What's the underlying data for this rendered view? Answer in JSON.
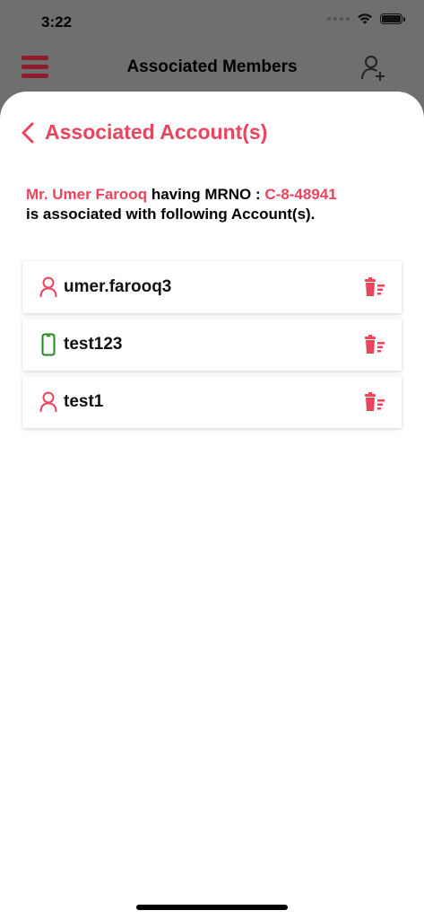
{
  "status_bar": {
    "time": "3:22"
  },
  "nav": {
    "title": "Associated Members"
  },
  "sheet": {
    "title": "Associated Account(s)",
    "info": {
      "name": "Mr. Umer  Farooq",
      "having": " having MRNO : ",
      "mrno": "C-8-48941",
      "line2": "is associated with following Account(s)."
    }
  },
  "accounts": [
    {
      "label": "umer.farooq3",
      "icon": "user-icon"
    },
    {
      "label": "test123",
      "icon": "phone-icon"
    },
    {
      "label": "test1",
      "icon": "user-icon"
    }
  ],
  "colors": {
    "accent": "#e8465c",
    "menu": "#8e1c2c",
    "phone": "#1f8a1f"
  }
}
